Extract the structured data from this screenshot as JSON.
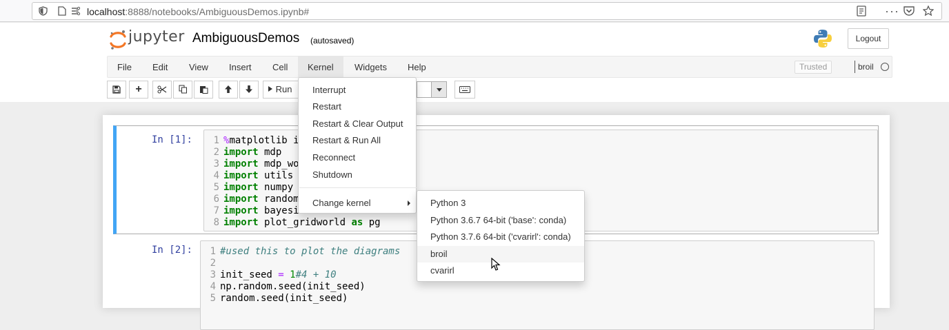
{
  "browser": {
    "url_host": "localhost",
    "url_rest": ":8888/notebooks/AmbiguousDemos.ipynb#"
  },
  "header": {
    "logo_text": "jupyter",
    "notebook_name": "AmbiguousDemos",
    "autosave_status": "(autosaved)",
    "logout_label": "Logout"
  },
  "menubar": {
    "items": [
      "File",
      "Edit",
      "View",
      "Insert",
      "Cell",
      "Kernel",
      "Widgets",
      "Help"
    ],
    "active": "Kernel",
    "trusted_label": "Trusted",
    "kernel_name": "broil"
  },
  "toolbar": {
    "run_label": "Run"
  },
  "cells": [
    {
      "prompt": "In [1]:",
      "lines": [
        {
          "n": "1",
          "html": "<span class='mg'>%</span>matplotlib i"
        },
        {
          "n": "2",
          "html": "<span class='kw'>import</span> mdp"
        },
        {
          "n": "3",
          "html": "<span class='kw'>import</span> mdp_wo"
        },
        {
          "n": "4",
          "html": "<span class='kw'>import</span> utils"
        },
        {
          "n": "5",
          "html": "<span class='kw'>import</span> numpy"
        },
        {
          "n": "6",
          "html": "<span class='kw'>import</span> random"
        },
        {
          "n": "7",
          "html": "<span class='kw'>import</span> bayesi"
        },
        {
          "n": "8",
          "html": "<span class='kw'>import</span> plot_gridworld <span class='kw'>as</span> pg"
        }
      ]
    },
    {
      "prompt": "In [2]:",
      "lines": [
        {
          "n": "1",
          "html": "<span class='cm'>#used this to plot the diagrams</span>"
        },
        {
          "n": "2",
          "html": ""
        },
        {
          "n": "3",
          "html": "init_seed <span class='op'>=</span> <span class='num'>1</span><span class='cm'>#4 + 10</span>"
        },
        {
          "n": "4",
          "html": "np.random.seed(init_seed)"
        },
        {
          "n": "5",
          "html": "random.seed(init_seed)"
        }
      ]
    }
  ],
  "kernel_menu": {
    "items": [
      "Interrupt",
      "Restart",
      "Restart & Clear Output",
      "Restart & Run All",
      "Reconnect",
      "Shutdown"
    ],
    "change_kernel_label": "Change kernel"
  },
  "change_kernel_submenu": {
    "items": [
      "Python 3",
      "Python 3.6.7 64-bit ('base': conda)",
      "Python 3.7.6 64-bit ('cvarirl': conda)",
      "broil",
      "cvarirl"
    ],
    "hovered": "broil"
  }
}
